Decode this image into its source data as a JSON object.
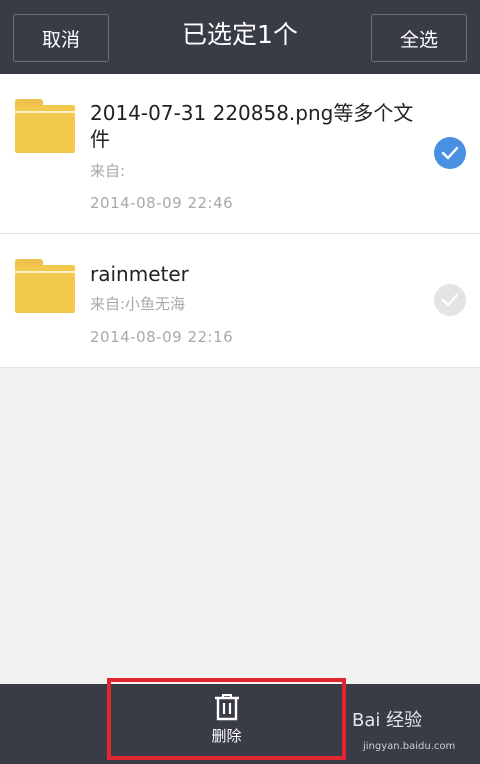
{
  "header": {
    "cancel_label": "取消",
    "title": "已选定1个",
    "select_all_label": "全选"
  },
  "files": [
    {
      "name": "2014-07-31 220858.png等多个文件",
      "from": "来自:",
      "time": "2014-08-09  22:46",
      "checked": true
    },
    {
      "name": "rainmeter",
      "from": "来自:小鱼无海",
      "time": "2014-08-09  22:16",
      "checked": false
    }
  ],
  "bottom": {
    "delete_label": "删除",
    "delete_icon": "trash-icon"
  },
  "watermark": {
    "brand": "Bai 经验",
    "url": "jingyan.baidu.com"
  },
  "colors": {
    "topbar": "#393b47",
    "check_on": "#4a90e2",
    "folder": "#f2c94c",
    "highlight_box": "#e0262e"
  }
}
